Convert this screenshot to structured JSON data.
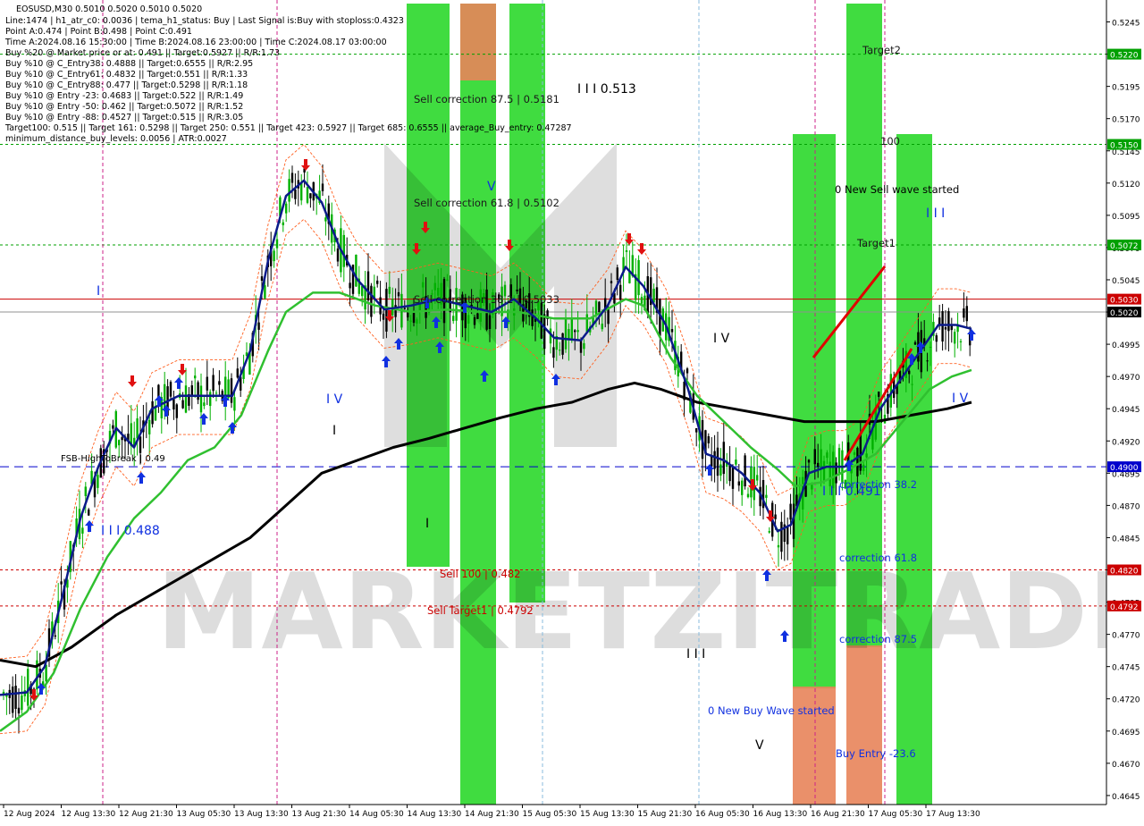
{
  "window": {
    "symbol_header": "EOSUSD,M30  0.5010 0.5020 0.5010 0.5020"
  },
  "info_lines": [
    "Line:1474 | h1_atr_c0: 0.0036 | tema_h1_status: Buy | Last Signal is:Buy with stoploss:0.4323",
    "Point A:0.474 | Point B:0.498 | Point C:0.491",
    "Time A:2024.08.16 15:30:00 | Time B:2024.08.16 23:00:00 | Time C:2024.08.17 03:00:00",
    "Buy %20 @ Market price or at: 0.491 || Target:0.5927 || R/R:1.73",
    "Buy %10 @ C_Entry38: 0.4888 || Target:0.6555 || R/R:2.95",
    "Buy %10 @ C_Entry61: 0.4832 || Target:0.551 || R/R:1.33",
    "Buy %10 @ C_Entry88: 0.477 || Target:0.5298 || R/R:1.18",
    "Buy %10 @ Entry -23: 0.4683 || Target:0.522 || R/R:1.49",
    "Buy %10 @ Entry -50: 0.462 || Target:0.5072 || R/R:1.52",
    "Buy %10 @ Entry -88: 0.4527 || Target:0.515 || R/R:3.05",
    "Target100: 0.515 || Target 161: 0.5298 || Target 250: 0.551 || Target 423: 0.5927 || Target 685: 0.6555 || average_Buy_entry: 0.47287",
    "minimum_distance_buy_levels: 0.0056 | ATR:0.0027"
  ],
  "annotations": {
    "sell_corr_875": "Sell correction 87.5 | 0.5181",
    "sell_corr_618": "Sell correction 61.8 | 0.5102",
    "sell_corr_382": "Sell correction 38.2 | 0.5033",
    "sell_100": "Sell 100 | 0.482",
    "sell_target1": "Sell Target1 | 0.4792",
    "wave_513": "I I I 0.513",
    "wave_488": "I I I 0.488",
    "wave_491": "I I I 0.491",
    "fsb_label": "FSB-HighToBreak | 0.49",
    "wave_V_top": "V",
    "wave_V_bottom": "V",
    "wave_IV_left": "I V",
    "wave_IV_mid": "I V",
    "wave_IV_right": "I V",
    "wave_III_bottom": "I I I",
    "wave_III_right": "I I I",
    "wave_I_left": "I",
    "wave_I_low": "I",
    "wave_I_mid": "I",
    "target2": "Target2",
    "target1": "Target1",
    "label_100": "100",
    "new_sell_wave": "0 New Sell wave started",
    "new_buy_wave": "0 New Buy Wave started",
    "correction_382": "correction 38.2",
    "correction_618": "correction 61.8",
    "correction_875": "correction 87.5",
    "buy_entry_236": "Buy Entry -23.6",
    "watermark": "MARKETZITRADE"
  },
  "colors": {
    "background": "#ffffff",
    "bull_candle": "#00b000",
    "bear_candle": "#000000",
    "green_zone": "#00d000",
    "orange_zone": "#e8845a",
    "ma_fast": "#0a1a8a",
    "ma_mid": "#30c030",
    "ma_slow": "#000000",
    "envelope": "#ff6020",
    "level_red": "#cc0000",
    "level_green": "#00a000",
    "level_blue": "#0000cc",
    "arrow_buy": "#1030e0",
    "arrow_sell": "#e01010",
    "axis_text": "#000000"
  },
  "chart_data": {
    "type": "candlestick",
    "symbol": "EOSUSD",
    "timeframe": "M30",
    "ylim": [
      0.4638,
      0.5262
    ],
    "price_ticks": [
      "0.5245",
      "0.5220",
      "0.5195",
      "0.5170",
      "0.5145",
      "0.5120",
      "0.5095",
      "0.5070",
      "0.5045",
      "0.5020",
      "0.4995",
      "0.4970",
      "0.4945",
      "0.4920",
      "0.4895",
      "0.4870",
      "0.4845",
      "0.4820",
      "0.4795",
      "0.4770",
      "0.4745",
      "0.4720",
      "0.4695",
      "0.4670",
      "0.4645"
    ],
    "time_ticks": [
      "12 Aug 2024",
      "12 Aug 13:30",
      "12 Aug 21:30",
      "13 Aug 05:30",
      "13 Aug 13:30",
      "13 Aug 21:30",
      "14 Aug 05:30",
      "14 Aug 13:30",
      "14 Aug 21:30",
      "15 Aug 05:30",
      "15 Aug 13:30",
      "15 Aug 21:30",
      "16 Aug 05:30",
      "16 Aug 13:30",
      "16 Aug 21:30",
      "17 Aug 05:30",
      "17 Aug 13:30"
    ],
    "highlighted_levels": [
      {
        "label": "0.5220",
        "value": 0.522,
        "color": "#00a000"
      },
      {
        "label": "0.5150",
        "value": 0.515,
        "color": "#00a000"
      },
      {
        "label": "0.5072",
        "value": 0.5072,
        "color": "#00a000"
      },
      {
        "label": "0.5030",
        "value": 0.503,
        "color": "#cc0000"
      },
      {
        "label": "0.5020",
        "value": 0.502,
        "color": "#000000"
      },
      {
        "label": "0.4900",
        "value": 0.49,
        "color": "#0000cc"
      },
      {
        "label": "0.4820",
        "value": 0.482,
        "color": "#cc0000"
      },
      {
        "label": "0.4792",
        "value": 0.4792,
        "color": "#cc0000"
      }
    ],
    "ma_fast_points": [
      [
        0,
        0.4723
      ],
      [
        30,
        0.4725
      ],
      [
        50,
        0.4745
      ],
      [
        70,
        0.48
      ],
      [
        90,
        0.486
      ],
      [
        110,
        0.49
      ],
      [
        130,
        0.493
      ],
      [
        150,
        0.4915
      ],
      [
        170,
        0.4945
      ],
      [
        200,
        0.4955
      ],
      [
        230,
        0.4955
      ],
      [
        260,
        0.4955
      ],
      [
        280,
        0.499
      ],
      [
        300,
        0.506
      ],
      [
        320,
        0.511
      ],
      [
        340,
        0.5122
      ],
      [
        360,
        0.5105
      ],
      [
        380,
        0.507
      ],
      [
        400,
        0.5045
      ],
      [
        430,
        0.5022
      ],
      [
        460,
        0.5025
      ],
      [
        490,
        0.503
      ],
      [
        520,
        0.5025
      ],
      [
        550,
        0.502
      ],
      [
        575,
        0.503
      ],
      [
        600,
        0.5015
      ],
      [
        620,
        0.5
      ],
      [
        650,
        0.4998
      ],
      [
        680,
        0.5025
      ],
      [
        700,
        0.5055
      ],
      [
        720,
        0.504
      ],
      [
        745,
        0.501
      ],
      [
        770,
        0.496
      ],
      [
        790,
        0.491
      ],
      [
        810,
        0.4905
      ],
      [
        830,
        0.4895
      ],
      [
        850,
        0.488
      ],
      [
        870,
        0.485
      ],
      [
        885,
        0.4855
      ],
      [
        905,
        0.4895
      ],
      [
        925,
        0.49
      ],
      [
        945,
        0.49
      ],
      [
        965,
        0.491
      ],
      [
        985,
        0.4945
      ],
      [
        1005,
        0.4965
      ],
      [
        1030,
        0.499
      ],
      [
        1050,
        0.501
      ],
      [
        1070,
        0.501
      ],
      [
        1087,
        0.5007
      ]
    ],
    "ma_mid_points": [
      [
        0,
        0.4695
      ],
      [
        30,
        0.471
      ],
      [
        60,
        0.474
      ],
      [
        90,
        0.479
      ],
      [
        120,
        0.483
      ],
      [
        150,
        0.486
      ],
      [
        180,
        0.488
      ],
      [
        210,
        0.4905
      ],
      [
        240,
        0.4915
      ],
      [
        270,
        0.494
      ],
      [
        300,
        0.499
      ],
      [
        320,
        0.502
      ],
      [
        350,
        0.5035
      ],
      [
        380,
        0.5035
      ],
      [
        420,
        0.5025
      ],
      [
        460,
        0.502
      ],
      [
        500,
        0.5022
      ],
      [
        540,
        0.502
      ],
      [
        580,
        0.502
      ],
      [
        620,
        0.5015
      ],
      [
        660,
        0.5015
      ],
      [
        700,
        0.503
      ],
      [
        720,
        0.5025
      ],
      [
        750,
        0.4985
      ],
      [
        780,
        0.4955
      ],
      [
        810,
        0.4935
      ],
      [
        840,
        0.4915
      ],
      [
        870,
        0.4898
      ],
      [
        890,
        0.4885
      ],
      [
        920,
        0.4888
      ],
      [
        950,
        0.4898
      ],
      [
        980,
        0.491
      ],
      [
        1010,
        0.4935
      ],
      [
        1040,
        0.496
      ],
      [
        1065,
        0.497
      ],
      [
        1087,
        0.4975
      ]
    ],
    "ma_slow_points": [
      [
        0,
        0.475
      ],
      [
        40,
        0.4745
      ],
      [
        80,
        0.476
      ],
      [
        130,
        0.4785
      ],
      [
        180,
        0.4805
      ],
      [
        230,
        0.4825
      ],
      [
        280,
        0.4845
      ],
      [
        320,
        0.487
      ],
      [
        360,
        0.4895
      ],
      [
        400,
        0.4905
      ],
      [
        440,
        0.4915
      ],
      [
        480,
        0.4922
      ],
      [
        520,
        0.493
      ],
      [
        560,
        0.4938
      ],
      [
        600,
        0.4945
      ],
      [
        640,
        0.495
      ],
      [
        680,
        0.496
      ],
      [
        710,
        0.4965
      ],
      [
        740,
        0.496
      ],
      [
        780,
        0.495
      ],
      [
        820,
        0.4945
      ],
      [
        860,
        0.494
      ],
      [
        900,
        0.4935
      ],
      [
        940,
        0.4935
      ],
      [
        980,
        0.4935
      ],
      [
        1020,
        0.494
      ],
      [
        1060,
        0.4945
      ],
      [
        1087,
        0.495
      ]
    ]
  }
}
